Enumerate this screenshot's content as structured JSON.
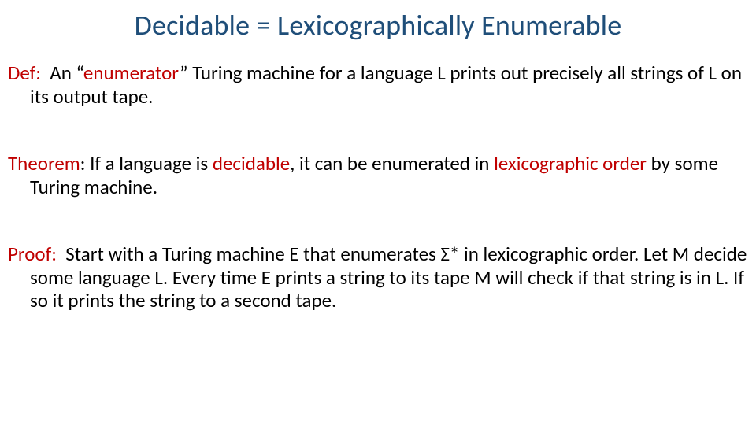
{
  "title": "Decidable = Lexicographically Enumerable",
  "def": {
    "label": "Def:",
    "before": "An “",
    "enumerator": "enumerator",
    "after": "” Turing machine for a language L prints out precisely all strings of L on its output tape."
  },
  "theorem": {
    "label": "Theorem",
    "mid1": ": If a language is ",
    "decidable": "decidable",
    "mid2": ", it can be enumerated in ",
    "lex": "lexicographic order",
    "tail": " by some Turing machine."
  },
  "proof": {
    "label": "Proof:",
    "text": "Start with a Turing machine E that enumerates Σ* in lexicographic order. Let M decide some language L. Every time E prints a string to its tape M will check if that string is in L. If so it prints the string to a second tape."
  }
}
